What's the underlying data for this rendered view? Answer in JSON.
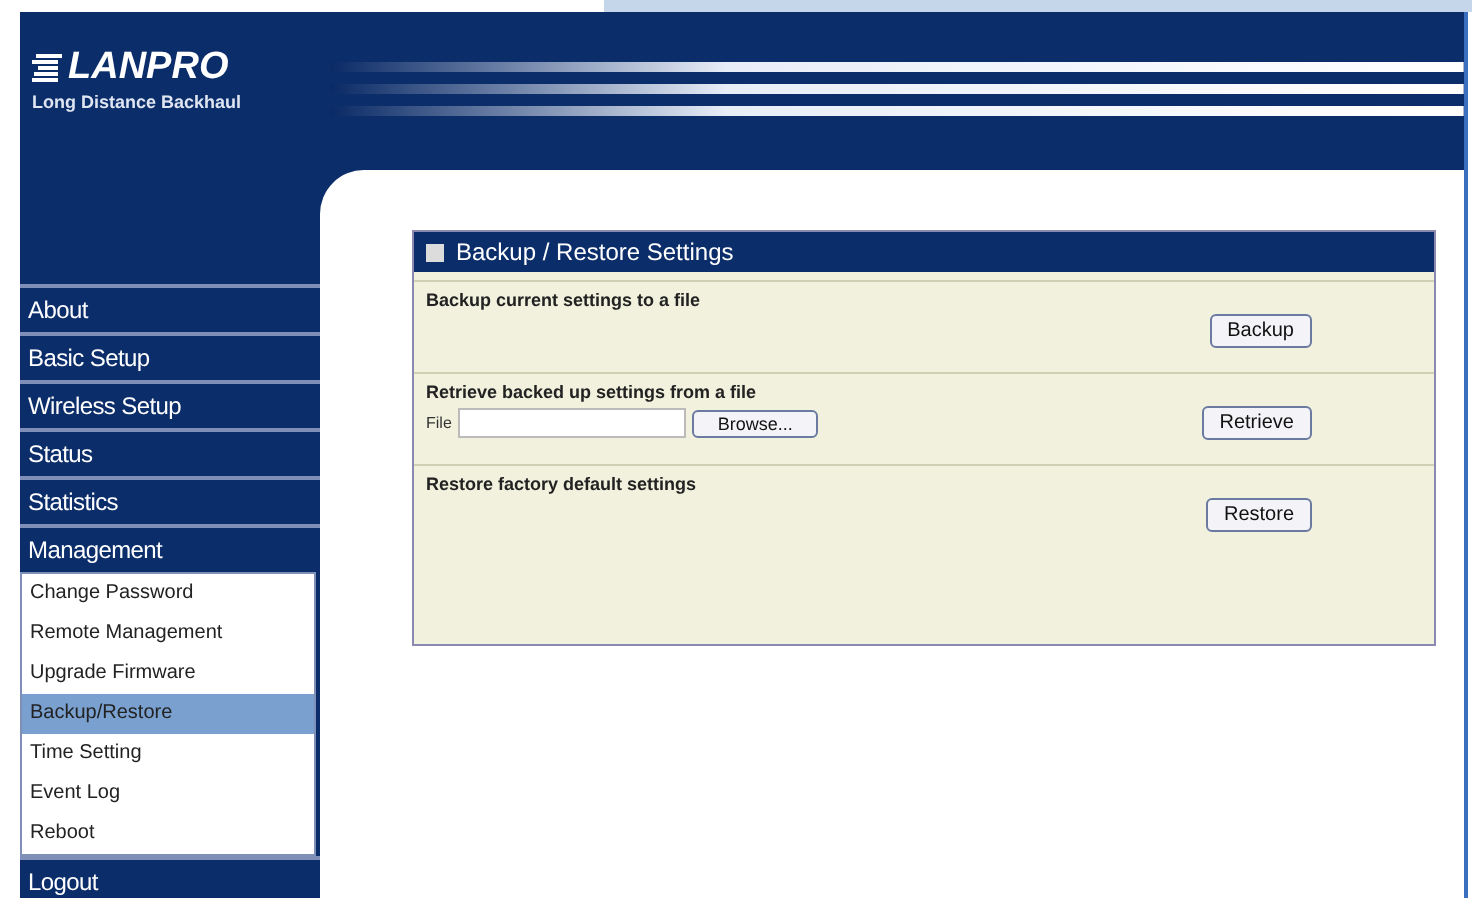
{
  "logo": {
    "brand": "LANPRO",
    "tagline": "Long Distance Backhaul"
  },
  "menu": [
    {
      "label": "About"
    },
    {
      "label": "Basic Setup"
    },
    {
      "label": "Wireless Setup"
    },
    {
      "label": "Status"
    },
    {
      "label": "Statistics"
    },
    {
      "label": "Management",
      "children": [
        {
          "label": "Change Password",
          "selected": false
        },
        {
          "label": "Remote Management",
          "selected": false
        },
        {
          "label": "Upgrade Firmware",
          "selected": false
        },
        {
          "label": "Backup/Restore",
          "selected": true
        },
        {
          "label": "Time Setting",
          "selected": false
        },
        {
          "label": "Event Log",
          "selected": false
        },
        {
          "label": "Reboot",
          "selected": false
        }
      ]
    },
    {
      "label": "Logout"
    }
  ],
  "panel": {
    "title": "Backup / Restore Settings",
    "sections": [
      {
        "kind": "plain",
        "label": "Backup current settings to a file",
        "button": "Backup"
      },
      {
        "kind": "file",
        "label": "Retrieve backed up settings from a file",
        "field_label": "File",
        "browse": "Browse...",
        "button": "Retrieve"
      },
      {
        "kind": "plain",
        "label": "Restore factory default settings",
        "button": "Restore"
      }
    ]
  }
}
